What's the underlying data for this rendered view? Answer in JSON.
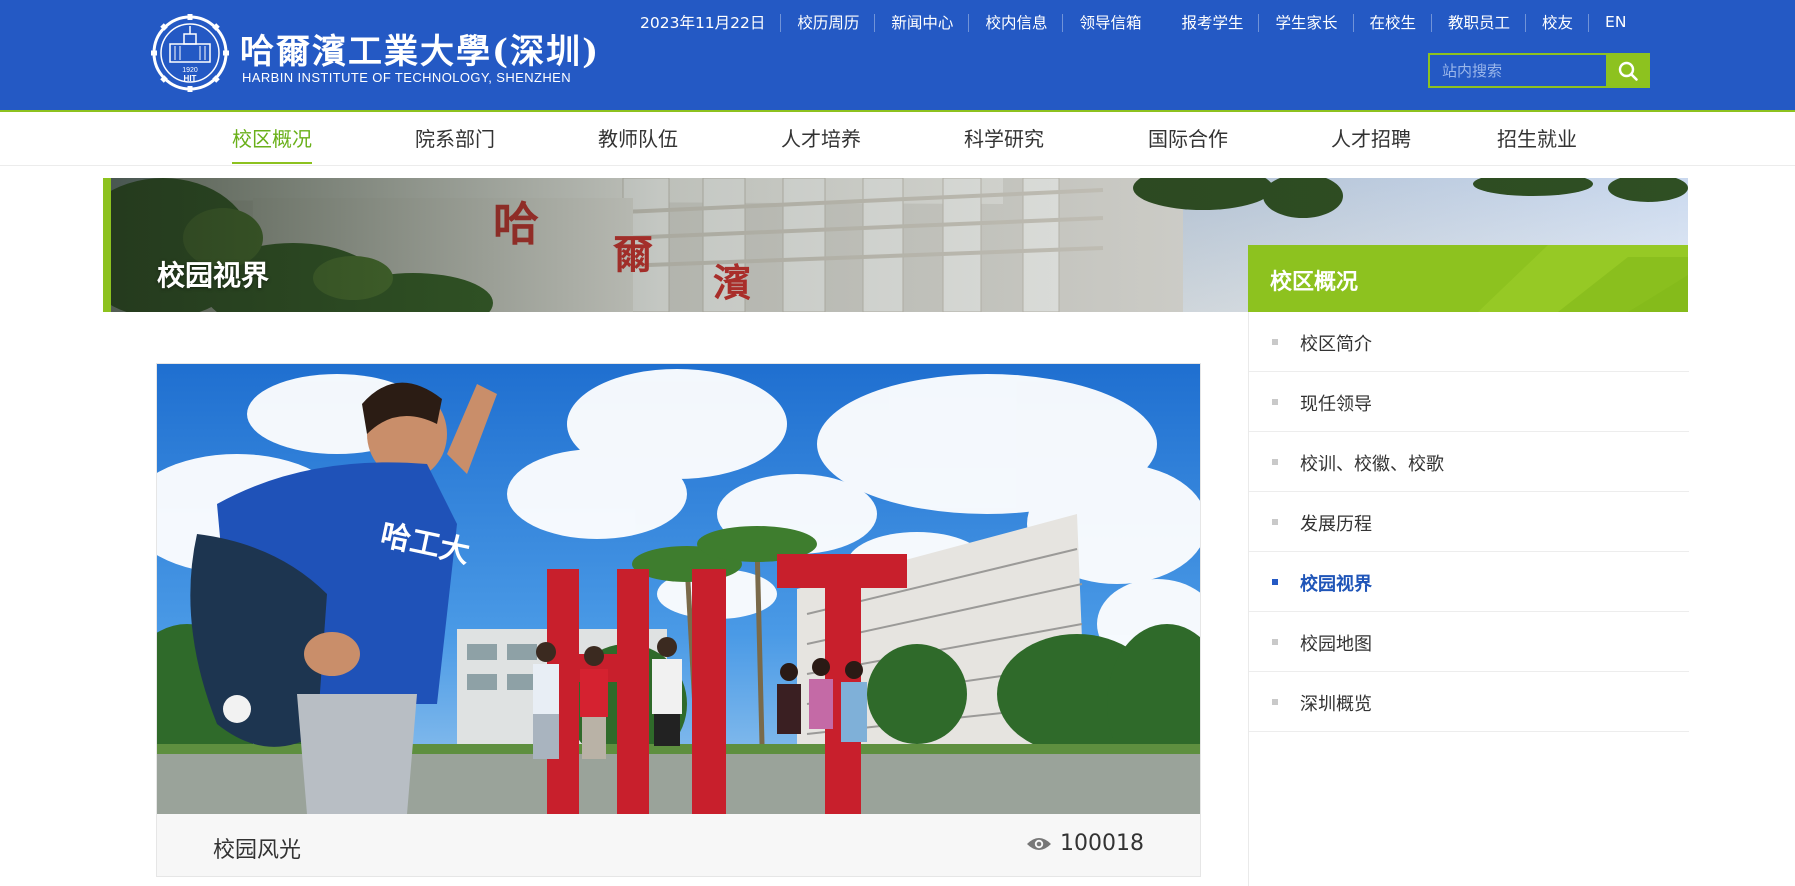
{
  "header": {
    "logo_cn": "哈爾濱工業大學(深圳)",
    "logo_en": "HARBIN INSTITUTE OF TECHNOLOGY, SHENZHEN",
    "emblem_year": "1920",
    "emblem_text": "HIT",
    "date": "2023年11月22日",
    "links_a": [
      "校历周历",
      "新闻中心",
      "校内信息",
      "领导信箱"
    ],
    "links_b": [
      "报考学生",
      "学生家长",
      "在校生",
      "教职员工",
      "校友",
      "EN"
    ],
    "search_placeholder": "站内搜索"
  },
  "nav": {
    "items": [
      "校区概况",
      "院系部门",
      "教师队伍",
      "人才培养",
      "科学研究",
      "国际合作",
      "人才招聘",
      "招生就业"
    ],
    "active_index": 0
  },
  "banner": {
    "title": "校园视界"
  },
  "sidebar": {
    "title": "校区概况",
    "items": [
      "校区简介",
      "现任领导",
      "校训、校徽、校歌",
      "发展历程",
      "校园视界",
      "校园地图",
      "深圳概览"
    ],
    "active_index": 4
  },
  "gallery": {
    "caption": "校园风光",
    "views": "100018",
    "photo_sign_letters": "HIT",
    "shirt_text": "哈工大"
  },
  "colors": {
    "header_blue": "#2459c4",
    "accent_green": "#8dc21f",
    "active_link_blue": "#1f55b8"
  },
  "icons": [
    "search-icon",
    "eye-icon",
    "square-bullet-icon"
  ]
}
